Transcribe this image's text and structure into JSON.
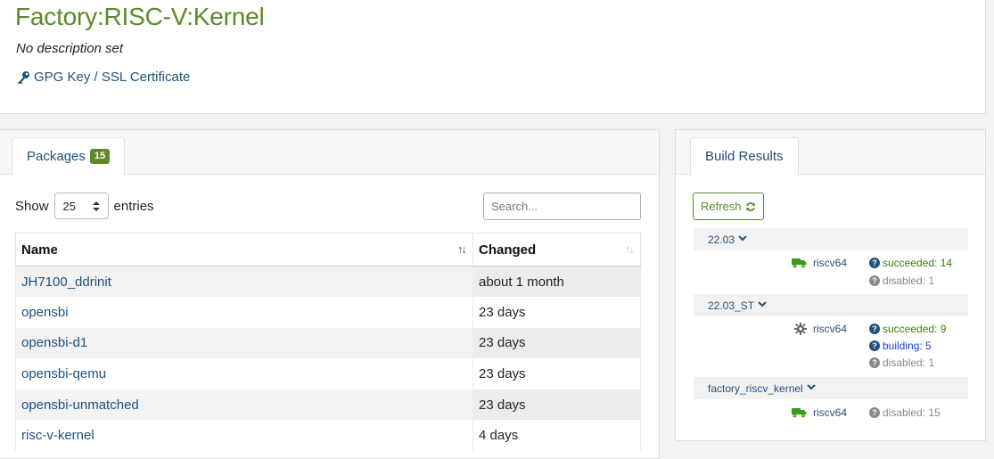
{
  "project": {
    "title": "Factory:RISC-V:Kernel",
    "description": "No description set",
    "gpg_link": "GPG Key / SSL Certificate"
  },
  "packages": {
    "tab_label": "Packages",
    "count": "15",
    "show_label": "Show",
    "entries_value": "25",
    "entries_label": "entries",
    "search_placeholder": "Search...",
    "columns": [
      "Name",
      "Changed"
    ],
    "rows": [
      {
        "name": "JH7100_ddrinit",
        "changed": "about 1 month"
      },
      {
        "name": "opensbi",
        "changed": "23 days"
      },
      {
        "name": "opensbi-d1",
        "changed": "23 days"
      },
      {
        "name": "opensbi-qemu",
        "changed": "23 days"
      },
      {
        "name": "opensbi-unmatched",
        "changed": "23 days"
      },
      {
        "name": "risc-v-kernel",
        "changed": "4 days"
      }
    ]
  },
  "build_results": {
    "tab_label": "Build Results",
    "refresh_label": "Refresh",
    "repos": [
      {
        "name": "22.03",
        "arch": "riscv64",
        "arch_icon": "truck-icon",
        "statuses": [
          {
            "kind": "succeeded",
            "text": "succeeded: 14"
          },
          {
            "kind": "disabled",
            "text": "disabled: 1"
          }
        ]
      },
      {
        "name": "22.03_ST",
        "arch": "riscv64",
        "arch_icon": "gear-icon",
        "statuses": [
          {
            "kind": "succeeded",
            "text": "succeeded: 9"
          },
          {
            "kind": "building",
            "text": "building: 5"
          },
          {
            "kind": "disabled",
            "text": "disabled: 1"
          }
        ]
      },
      {
        "name": "factory_riscv_kernel",
        "arch": "riscv64",
        "arch_icon": "truck-icon",
        "statuses": [
          {
            "kind": "disabled",
            "text": "disabled: 15"
          }
        ]
      }
    ]
  },
  "colors": {
    "brand_green": "#5c8a2a",
    "link_blue": "#21517a",
    "succeeded": "#3a7d0a",
    "building": "#1f3fd8",
    "disabled": "#888888"
  }
}
